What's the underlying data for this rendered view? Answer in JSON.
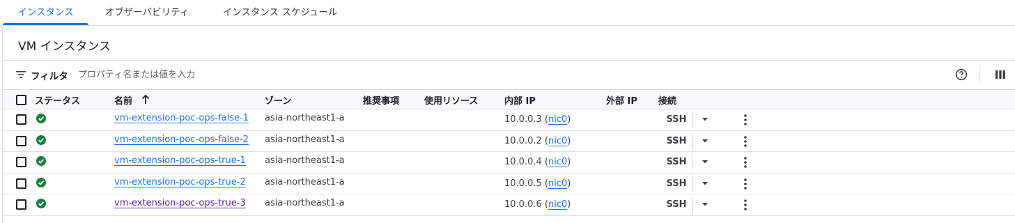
{
  "tabs": [
    {
      "label": "インスタンス",
      "active": true
    },
    {
      "label": "オブザーバビリティ",
      "active": false
    },
    {
      "label": "インスタンス スケジュール",
      "active": false
    }
  ],
  "page_title": "VM インスタンス",
  "filter": {
    "label": "フィルタ",
    "placeholder": "プロパティ名または値を入力"
  },
  "table": {
    "columns": [
      "ステータス",
      "名前",
      "ゾーン",
      "推奨事項",
      "使用リソース",
      "内部 IP",
      "外部 IP",
      "接続"
    ],
    "sort": {
      "column": "名前",
      "direction": "ascending"
    },
    "rows": [
      {
        "status": "running",
        "name": "vm-extension-poc-ops-false-1",
        "zone": "asia-northeast1-a",
        "internal_ip": "10.0.0.3",
        "nic": "nic0",
        "connect": "SSH",
        "visited": false
      },
      {
        "status": "running",
        "name": "vm-extension-poc-ops-false-2",
        "zone": "asia-northeast1-a",
        "internal_ip": "10.0.0.2",
        "nic": "nic0",
        "connect": "SSH",
        "visited": false
      },
      {
        "status": "running",
        "name": "vm-extension-poc-ops-true-1",
        "zone": "asia-northeast1-a",
        "internal_ip": "10.0.0.4",
        "nic": "nic0",
        "connect": "SSH",
        "visited": false
      },
      {
        "status": "running",
        "name": "vm-extension-poc-ops-true-2",
        "zone": "asia-northeast1-a",
        "internal_ip": "10.0.0.5",
        "nic": "nic0",
        "connect": "SSH",
        "visited": false
      },
      {
        "status": "running",
        "name": "vm-extension-poc-ops-true-3",
        "zone": "asia-northeast1-a",
        "internal_ip": "10.0.0.6",
        "nic": "nic0",
        "connect": "SSH",
        "visited": true
      }
    ]
  },
  "icons": {
    "status": "check-circle-icon",
    "filter": "filter-icon",
    "help": "help-circle-icon",
    "columns": "column-display-icon",
    "sort": "arrow-up-icon",
    "dropdown": "caret-down-icon",
    "more": "more-vertical-icon"
  },
  "colors": {
    "accent": "#1a73e8",
    "status_ok": "#188038",
    "visited_link": "#681da8",
    "border": "#dadce0"
  }
}
